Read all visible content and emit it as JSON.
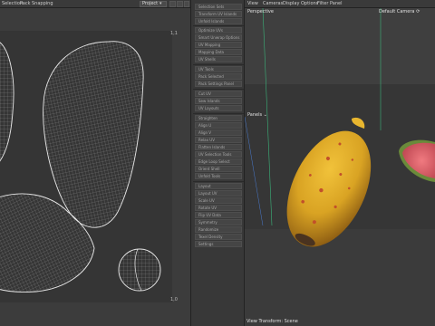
{
  "uv_editor": {
    "menu": [
      "Selection",
      "Pack",
      "Snapping"
    ],
    "dropdown_value": "Project",
    "top_marker": "1,1",
    "bottom_marker": "1,0"
  },
  "tool_panel": {
    "items": [
      "Selection Sets",
      "Transform UV Islands",
      "Unfold Islands",
      "Optimize UVs",
      "Smart Unwrap Options",
      "UV Mapping",
      "Mapping Data",
      "UV Shells",
      "UV Tools",
      "Pack Selected",
      "Pack Settings Panel",
      "Cut UV",
      "Sew Islands",
      "UV Layouts",
      "Straighten",
      "Align U",
      "Align V",
      "Relax UV",
      "Flatten Islands",
      "UV Selection Tools",
      "Edge Loop Select",
      "Orient Shell",
      "Unfold Tools",
      "Layout",
      "Layout UV",
      "Scale UV",
      "Rotate UV",
      "Flip UV Data",
      "Symmetry",
      "Randomize",
      "Texel Density",
      "Settings"
    ]
  },
  "viewport3d": {
    "menu": [
      "View",
      "Cameras",
      "Display",
      "Options",
      "Filter",
      "Panel"
    ],
    "perspective_label": "Perspective",
    "camera_label": "Default Camera ⟳",
    "panel_label": "Panels ⌄",
    "footer": "View Transform: Scene"
  },
  "colors": {
    "panel_bg": "#383838",
    "uv_bg": "#3c3c3c",
    "viewport_bg": "#3b3b3b",
    "wire": "#d8d8d8",
    "fruit_yellow": "#d9a323",
    "fruit_spot": "#c2502a",
    "axis_green": "#3bb37a"
  }
}
